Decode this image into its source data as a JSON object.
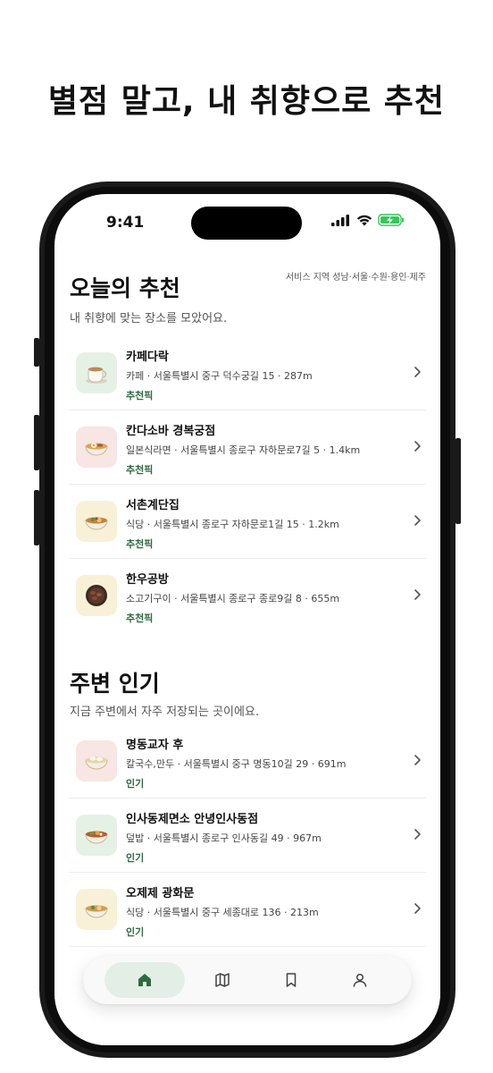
{
  "headline": "별점 말고, 내 취향으로 추천",
  "status_bar": {
    "time": "9:41"
  },
  "recommend": {
    "title": "오늘의 추천",
    "subtitle": "내 취향에 맞는 장소를 모았어요.",
    "service_area": "서비스 지역 성남·서울·수원·용인·제주",
    "items": [
      {
        "name": "카페다락",
        "meta": "카페 · 서울특별시 중구 덕수궁길 15 · 287m",
        "tag": "추천픽",
        "icon": "coffee-cup-icon",
        "tint": "#e6f1e6"
      },
      {
        "name": "칸다소바 경복궁점",
        "meta": "일본식라면 · 서울특별시 종로구 자하문로7길 5 · 1.4km",
        "tag": "추천픽",
        "icon": "ramen-bowl-icon",
        "tint": "#f7e6e3"
      },
      {
        "name": "서촌계단집",
        "meta": "식당 · 서울특별시 종로구 자하문로1길 15 · 1.2km",
        "tag": "추천픽",
        "icon": "food-bowl-icon",
        "tint": "#f8f1d8"
      },
      {
        "name": "한우공방",
        "meta": "소고기구이 · 서울특별시 종로구 종로9길 8 · 655m",
        "tag": "추천픽",
        "icon": "grilled-beef-icon",
        "tint": "#f8f1d8"
      }
    ]
  },
  "popular": {
    "title": "주변 인기",
    "subtitle": "지금 주변에서 자주 저장되는 곳이에요.",
    "items": [
      {
        "name": "명동교자 후",
        "meta": "칼국수,만두 · 서울특별시 중구 명동10길 29 · 691m",
        "tag": "인기",
        "icon": "dumpling-bowl-icon",
        "tint": "#f7e6e3"
      },
      {
        "name": "인사동제면소 안녕인사동점",
        "meta": "덮밥 · 서울특별시 종로구 인사동길 49 · 967m",
        "tag": "인기",
        "icon": "rice-bowl-icon",
        "tint": "#e6f1e6"
      },
      {
        "name": "오제제 광화문",
        "meta": "식당 · 서울특별시 중구 세종대로 136 · 213m",
        "tag": "인기",
        "icon": "food-bowl-icon",
        "tint": "#f8f1d8"
      }
    ]
  },
  "tabbar": {
    "tabs": [
      {
        "icon": "home-icon",
        "active": true
      },
      {
        "icon": "map-icon",
        "active": false
      },
      {
        "icon": "bookmark-icon",
        "active": false
      },
      {
        "icon": "profile-icon",
        "active": false
      }
    ]
  },
  "colors": {
    "accent_green": "#2e6b43",
    "active_tab_bg": "#e3efe6"
  }
}
